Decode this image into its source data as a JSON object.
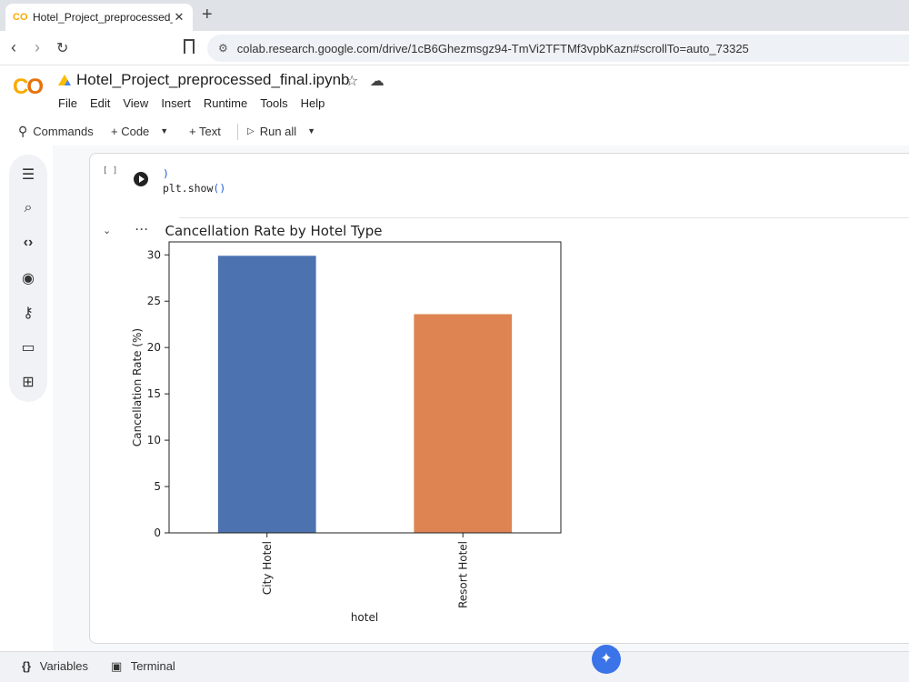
{
  "browser": {
    "tab_title": "Hotel_Project_preprocessed_final.ipy",
    "tab_favicon": "CO",
    "new_tab": "+",
    "url": "colab.research.google.com/drive/1cB6Ghezmsgz94-TmVi2TFTMf3vpbKazn#scrollTo=auto_73325"
  },
  "colab": {
    "notebook_title": "Hotel_Project_preprocessed_final.ipynb",
    "menu": [
      "File",
      "Edit",
      "View",
      "Insert",
      "Runtime",
      "Tools",
      "Help"
    ],
    "toolbar": {
      "commands": "Commands",
      "code": "+ Code",
      "text": "+ Text",
      "run_all": "Run all"
    }
  },
  "cell": {
    "bracket": "[ ]",
    "code_line1": ")",
    "code_line2_fn": "plt.show",
    "code_line2_args": "()",
    "output_dots": "···"
  },
  "chart_data": {
    "type": "bar",
    "title": "Cancellation Rate by Hotel Type",
    "xlabel": "hotel",
    "ylabel": "Cancellation Rate (%)",
    "categories": [
      "City Hotel",
      "Resort Hotel"
    ],
    "values": [
      29.9,
      23.6
    ],
    "colors": [
      "#4c72b0",
      "#dd8452"
    ],
    "yticks": [
      0,
      5,
      10,
      15,
      20,
      25,
      30
    ],
    "ylim": [
      0,
      31.4
    ],
    "grid": false,
    "legend": "none"
  },
  "bottom": {
    "variables": "Variables",
    "terminal": "Terminal"
  },
  "icons": [
    "back-icon",
    "forward-icon",
    "reload-icon",
    "bookmark-icon",
    "site-settings-icon",
    "star-icon",
    "cloud-icon",
    "search-icon",
    "run-icon",
    "toc-icon",
    "find-icon",
    "code-snippets-icon",
    "variables-inspector-icon",
    "key-icon",
    "folder-icon",
    "table-icon",
    "gemini-icon"
  ]
}
